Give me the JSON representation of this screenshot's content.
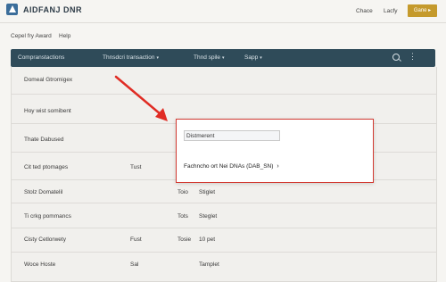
{
  "header": {
    "logo_icon": "logo-icon",
    "title": "AIDFANJ DNR",
    "links": [
      "Chace",
      "Lacfy"
    ],
    "cta_label": "Gane ▸",
    "accent_color": "#c59a2c"
  },
  "subnav": {
    "links": [
      "Cepel fry Award",
      "Help"
    ]
  },
  "table": {
    "header_color": "#2f4b59",
    "columns": [
      "Compranstactions",
      "Thnsdcri transaction",
      "Thnd spile",
      "Sapp"
    ],
    "icons": [
      "search-icon",
      "menu-icon"
    ],
    "rows": [
      [
        "Domeal Gtromigex",
        "",
        "",
        ""
      ],
      [
        "Hoy wist somibent",
        "",
        "",
        ""
      ],
      [
        "Thate Dabused",
        "",
        "",
        ""
      ],
      [
        "Cit ted ptomages",
        "Tust",
        "",
        ""
      ],
      [
        "Stolz Domatelil",
        "",
        "Toio",
        "Stiglet"
      ],
      [
        "Ti crkg pommancs",
        "",
        "Tots",
        "Steglet"
      ],
      [
        "Cisty Cetlorwety",
        "Fust",
        "Tosie",
        "10 pet"
      ],
      [
        "Woce Hoste",
        "Sal",
        "",
        "Tamplet"
      ]
    ]
  },
  "popup": {
    "input_value": "Distmerent",
    "option_label": "Fachncho ort Nei DNAs (DAB_SN)",
    "option_icon": "chevron-right-icon",
    "border_color": "#d23a32"
  },
  "annotation": {
    "arrow_color": "#e02c24"
  }
}
